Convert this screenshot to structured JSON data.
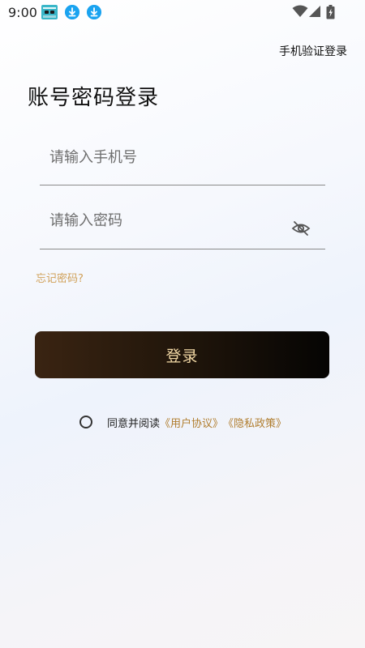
{
  "status_bar": {
    "time": "9:00",
    "icons": [
      "notification-app-icon",
      "download-icon",
      "download-icon",
      "wifi-icon",
      "cellular-signal-icon",
      "battery-charging-icon"
    ]
  },
  "header": {
    "sms_login_link": "手机验证登录"
  },
  "form": {
    "title": "账号密码登录",
    "phone_placeholder": "请输入手机号",
    "password_placeholder": "请输入密码",
    "forgot_password": "忘记密码?",
    "login_button": "登录"
  },
  "agreement": {
    "prefix": "同意并阅读",
    "user_agreement": "《用户协议》",
    "privacy_policy": "《隐私政策》",
    "checked": false
  },
  "colors": {
    "accent_gold": "#d0a058",
    "link_brown": "#b07d2e",
    "button_text": "#f3d9a6",
    "button_dark": "#1e140a",
    "status_download": "#1aa3f0"
  }
}
